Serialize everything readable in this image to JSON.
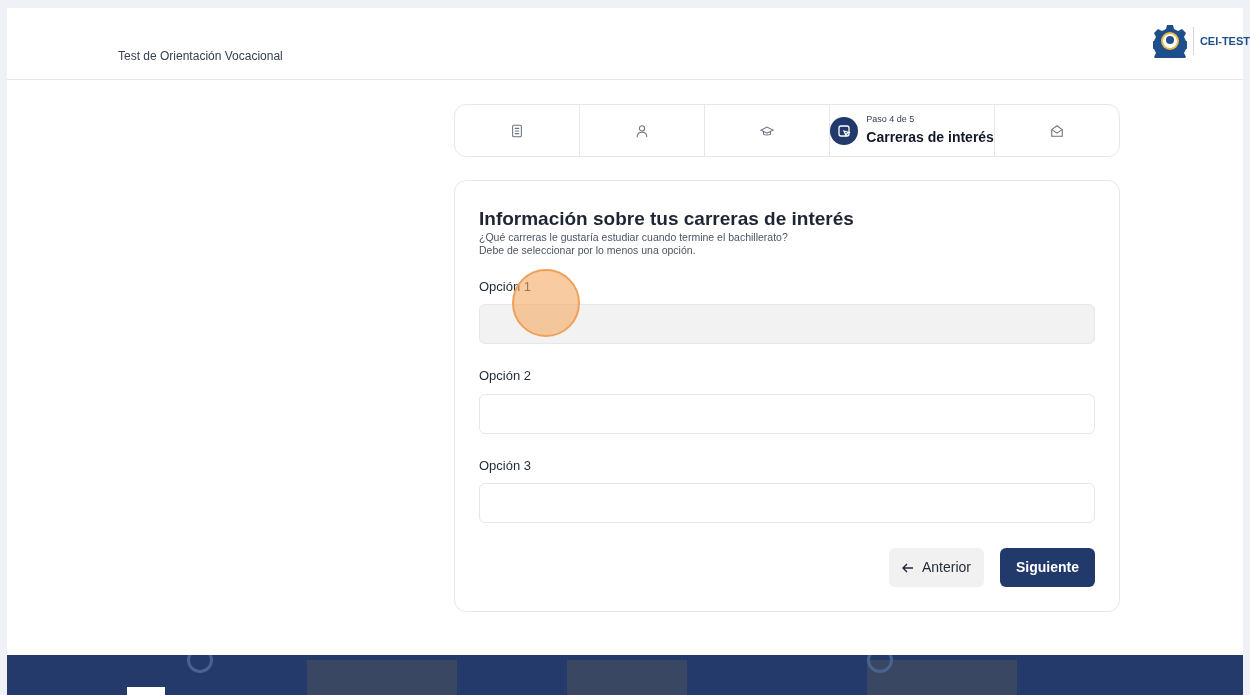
{
  "header": {
    "title": "Test de Orientación Vocacional",
    "logo_text": "CEI-TEST"
  },
  "steps": [
    {
      "kind": "document",
      "selected": false
    },
    {
      "kind": "person",
      "selected": false
    },
    {
      "kind": "cap",
      "selected": false
    },
    {
      "kind": "pointer",
      "selected": true,
      "caption": "Paso 4 de 5",
      "title": "Carreras de interés"
    },
    {
      "kind": "mail",
      "selected": false
    }
  ],
  "form": {
    "title": "Información sobre tus carreras de interés",
    "description": [
      "¿Qué carreras le gustaría estudiar cuando termine el bachillerato?",
      "Debe de seleccionar por lo menos una opción."
    ],
    "fields": [
      {
        "label": "Opción 1",
        "focused": true
      },
      {
        "label": "Opción 2",
        "focused": false
      },
      {
        "label": "Opción 3",
        "focused": false
      }
    ],
    "back_button": "Anterior",
    "next_button": "Siguiente"
  }
}
